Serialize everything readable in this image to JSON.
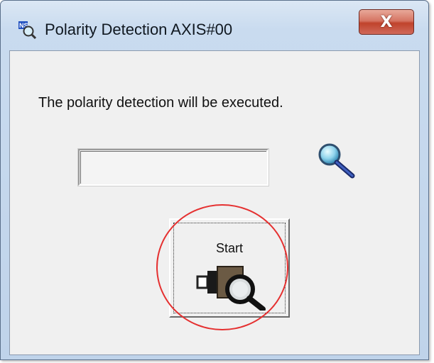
{
  "window": {
    "title": "Polarity Detection AXIS#00",
    "close_label": "X"
  },
  "dialog": {
    "message": "The polarity detection will be executed.",
    "status_value": "",
    "start_label": "Start"
  },
  "icons": {
    "app": "ns-magnifier-app-icon",
    "status": "magnifier-icon",
    "start": "motor-magnifier-icon"
  },
  "colors": {
    "highlight_ring": "#e53030",
    "close_button": "#c0432c"
  }
}
